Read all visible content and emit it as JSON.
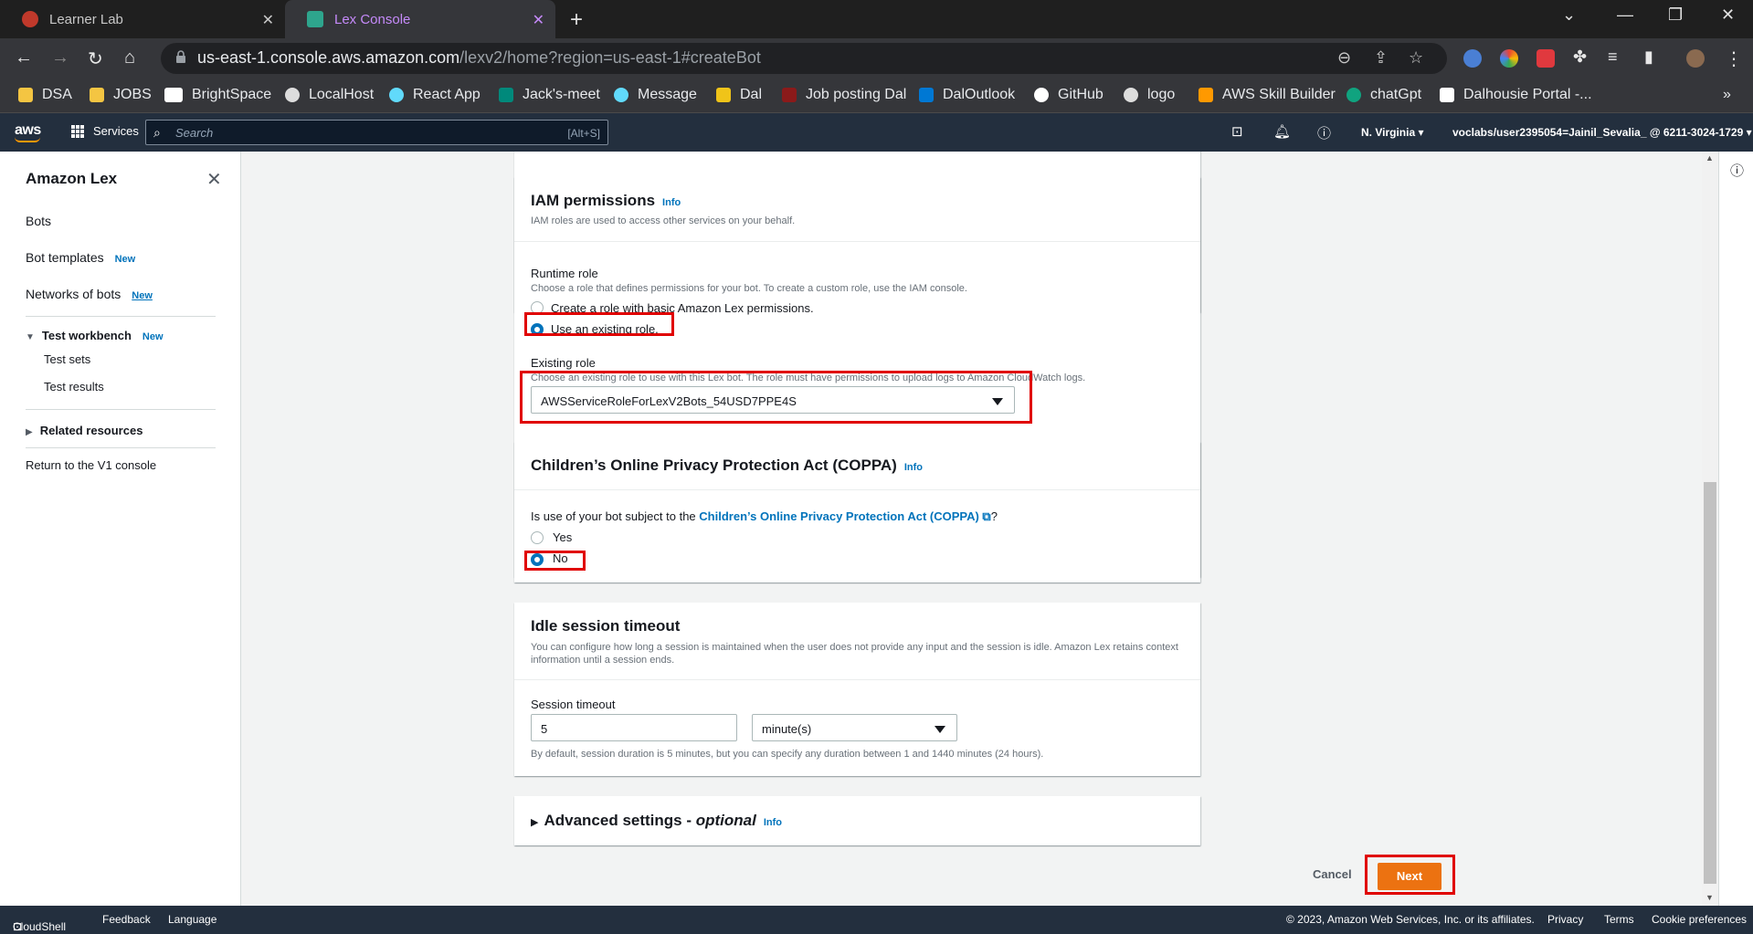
{
  "browser": {
    "tabs": [
      {
        "title": "Learner Lab",
        "active": false
      },
      {
        "title": "Lex Console",
        "active": true
      }
    ],
    "url_host": "us-east-1.console.aws.amazon.com",
    "url_path": "/lexv2/home?region=us-east-1#createBot",
    "bookmarks": [
      "DSA",
      "JOBS",
      "BrightSpace",
      "LocalHost",
      "React App",
      "Jack's-meet",
      "Message",
      "Dal",
      "Job posting Dal",
      "DalOutlook",
      "GitHub",
      "logo",
      "AWS Skill Builder",
      "chatGpt",
      "Dalhousie Portal -..."
    ],
    "bookmark_more": "»"
  },
  "awsnav": {
    "logo": "aws",
    "services": "Services",
    "search_placeholder": "Search",
    "search_shortcut": "[Alt+S]",
    "region": "N. Virginia ▾",
    "account": "voclabs/user2395054=Jainil_Sevalia_ @ 6211-3024-1729 ▾"
  },
  "sidebar": {
    "title": "Amazon Lex",
    "items": {
      "bots": "Bots",
      "bot_templates": "Bot templates",
      "networks": "Networks of bots",
      "test_workbench": "Test workbench",
      "test_sets": "Test sets",
      "test_results": "Test results",
      "related": "Related resources",
      "return_v1": "Return to the V1 console"
    },
    "new_badge": "New"
  },
  "iam": {
    "title": "IAM permissions",
    "info": "Info",
    "desc": "IAM roles are used to access other services on your behalf.",
    "runtime_label": "Runtime role",
    "runtime_desc": "Choose a role that defines permissions for your bot. To create a custom role, use the IAM console.",
    "opt_create": "Create a role with basic Amazon Lex permissions.",
    "opt_existing": "Use an existing role.",
    "existing_label": "Existing role",
    "existing_desc": "Choose an existing role to use with this Lex bot. The role must have permissions to upload logs to Amazon CloudWatch logs.",
    "existing_value": "AWSServiceRoleForLexV2Bots_54USD7PPE4S"
  },
  "coppa": {
    "title": "Children’s Online Privacy Protection Act (COPPA)",
    "info": "Info",
    "q_prefix": "Is use of your bot subject to the ",
    "q_link": "Children’s Online Privacy Protection Act (COPPA)",
    "q_suffix": "?",
    "yes": "Yes",
    "no": "No"
  },
  "idle": {
    "title": "Idle session timeout",
    "desc": "You can configure how long a session is maintained when the user does not provide any input and the session is idle. Amazon Lex retains context information until a session ends.",
    "session_label": "Session timeout",
    "session_value": "5",
    "unit": "minute(s)",
    "hint": "By default, session duration is 5 minutes, but you can specify any duration between 1 and 1440 minutes (24 hours)."
  },
  "advanced": {
    "title": "Advanced settings - ",
    "optional": "optional",
    "info": "Info"
  },
  "actions": {
    "cancel": "Cancel",
    "next": "Next"
  },
  "footer": {
    "cloudshell": "CloudShell",
    "feedback": "Feedback",
    "language": "Language",
    "copyright": "© 2023, Amazon Web Services, Inc. or its affiliates.",
    "privacy": "Privacy",
    "terms": "Terms",
    "cookies": "Cookie preferences"
  },
  "colors": {
    "accent": "#0073bb",
    "primary_button": "#ec7211",
    "highlight": "#e00000",
    "aws_nav": "#232f3e"
  }
}
